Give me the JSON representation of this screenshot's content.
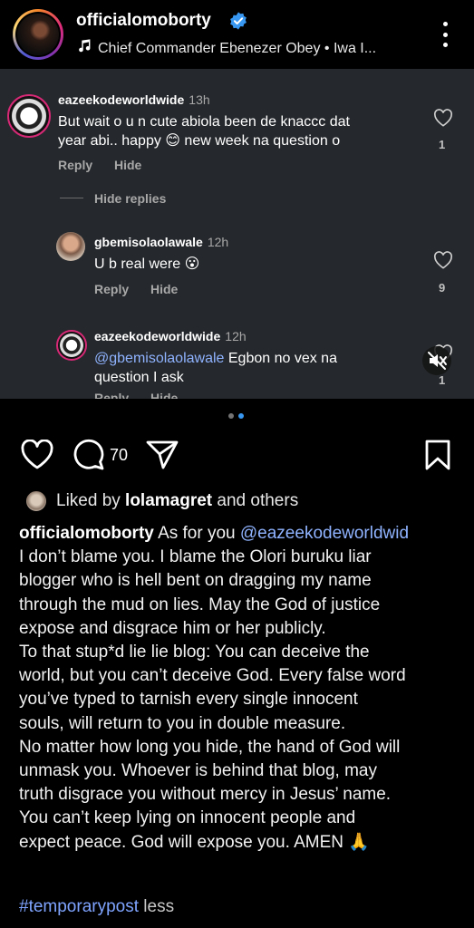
{
  "header": {
    "username": "officialomoborty",
    "music": "Chief Commander Ebenezer Obey • Iwa I...",
    "icons": {
      "verified": "verified-badge-icon",
      "music": "music-note-icon",
      "more": "more-vertical-icon"
    },
    "verified_color": "#3897f0"
  },
  "media": {
    "background": "#25282c",
    "comments": [
      {
        "username": "eazeekodeworldwide",
        "time": "13h",
        "text_line1": "But wait o u n cute abiola been de knaccc dat",
        "text_line2": "year abi.. happy 😊 new week na question o",
        "reply_label": "Reply",
        "hide_label": "Hide",
        "likes": "1"
      },
      {
        "hide_replies_label": "Hide replies"
      },
      {
        "username": "gbemisolaolawale",
        "time": "12h",
        "text": "U b real were 😮",
        "reply_label": "Reply",
        "hide_label": "Hide",
        "likes": "9"
      },
      {
        "username": "eazeekodeworldwide",
        "time": "12h",
        "mention": "@gbemisolaolawale",
        "text_line1_rest": " Egbon no vex na",
        "text_line2": "question I ask",
        "reply_label": "Reply",
        "hide_label": "Hide",
        "likes": "1"
      }
    ]
  },
  "carousel": {
    "active_index": 1,
    "count": 2,
    "active_color": "#3897f0",
    "inactive_color": "#737373"
  },
  "actions": {
    "comment_count": "70",
    "icons": [
      "heart-icon",
      "comment-icon",
      "share-icon",
      "bookmark-icon"
    ]
  },
  "likes": {
    "prefix": "Liked by ",
    "user": "lolamagret",
    "suffix": " and others"
  },
  "caption": {
    "username": "officialomoborty",
    "first_line_text": " As for you ",
    "mention": "@eazeekodeworldwid",
    "lines": [
      "I don’t blame you. I blame the Olori buruku liar",
      "blogger who is hell bent on dragging my name",
      "through the mud on lies. May the God of justice",
      "expose and disgrace him or her publicly.",
      "To that stup*d lie lie blog: You can deceive the",
      "world, but you can’t deceive God. Every false word",
      "you’ve typed to tarnish every single innocent",
      "souls, will return to you in double measure.",
      "No matter how long you hide, the hand of God will",
      "unmask you. Whoever is behind that blog, may",
      "truth disgrace you without mercy in Jesus’ name.",
      "You can’t keep lying on innocent people and",
      "expect peace. God will expose you. AMEN 🙏"
    ],
    "hashtag": "#temporarypost",
    "less_label": " less"
  }
}
